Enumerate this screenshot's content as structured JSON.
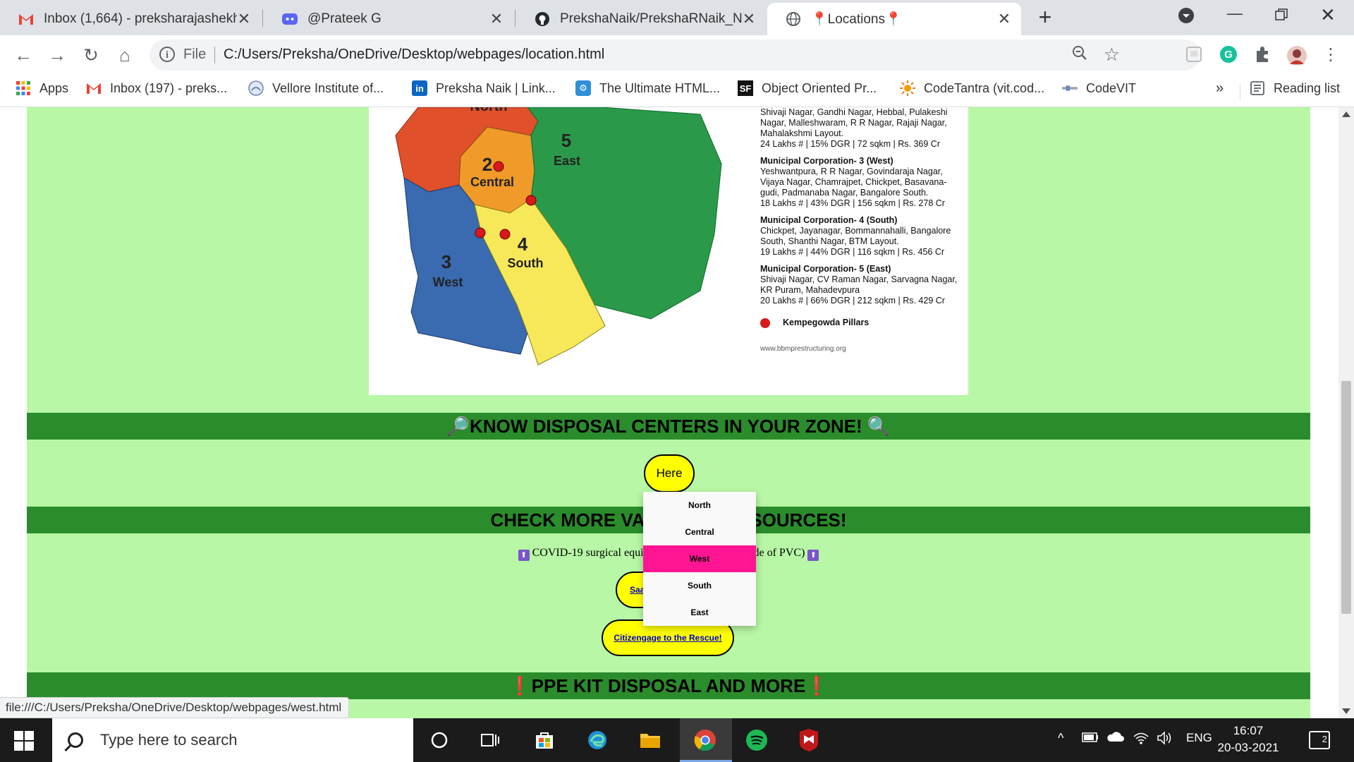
{
  "tabs": [
    {
      "title": "Inbox (1,664) - preksharajashekh...",
      "favicon": "gmail-icon"
    },
    {
      "title": "@Prateek G",
      "favicon": "discord-icon"
    },
    {
      "title": "PrekshaNaik/PrekshaRNaik_NMIT",
      "favicon": "github-icon"
    },
    {
      "title": "📍Locations📍",
      "favicon": "globe-icon"
    }
  ],
  "address": {
    "scheme_label": "File",
    "url": "C:/Users/Preksha/OneDrive/Desktop/webpages/location.html"
  },
  "bookmarks": {
    "apps": "Apps",
    "items": [
      "Inbox (197) - preks...",
      "Vellore Institute of...",
      "Preksha Naik | Link...",
      "The Ultimate HTML...",
      "Object Oriented Pr...",
      "CodeTantra (vit.cod...",
      "CodeVIT"
    ],
    "more": "»",
    "reading_list": "Reading list"
  },
  "map": {
    "zones": [
      {
        "number": "",
        "name": "North"
      },
      {
        "number": "2",
        "name": "Central"
      },
      {
        "number": "3",
        "name": "West"
      },
      {
        "number": "4",
        "name": "South"
      },
      {
        "number": "5",
        "name": "East"
      }
    ],
    "legend": [
      {
        "title": "",
        "body": "Shivaji Nagar, Gandhi Nagar, Hebbal, Pulakeshi Nagar, Malleshwaram, R R Nagar, Rajaji Nagar, Mahalakshmi Layout.",
        "stats": "24 Lakhs # | 15% DGR | 72 sqkm | Rs. 369 Cr"
      },
      {
        "title": "Municipal Corporation- 3 (West)",
        "body": "Yeshwantpura, R R Nagar, Govindaraja Nagar, Vijaya Nagar, Chamrajpet, Chickpet, Basavana-gudi, Padmanaba Nagar, Bangalore South.",
        "stats": "18 Lakhs # | 43% DGR | 156 sqkm | Rs. 278 Cr"
      },
      {
        "title": "Municipal Corporation- 4 (South)",
        "body": "Chickpet, Jayanagar, Bommannahalli, Bangalore South, Shanthi Nagar, BTM Layout.",
        "stats": "19 Lakhs # | 44% DGR | 116 sqkm | Rs. 456 Cr"
      },
      {
        "title": "Municipal Corporation- 5 (East)",
        "body": "Shivaji Nagar, CV Raman Nagar, Sarvagna Nagar, KR Puram, Mahadevpura",
        "stats": "20 Lakhs # | 66% DGR | 212 sqkm | Rs. 429 Cr"
      }
    ],
    "pillars_label": "Kempegowda Pillars",
    "website": "www.bbmprestructuring.org"
  },
  "sections": {
    "know_zone": "🔎KNOW DISPOSAL CENTERS IN YOUR ZONE! 🔍",
    "here_button": "Here",
    "check_more": "CHECK MORE VALUABLE RESOURCES!",
    "resource_text": "COVID-19 surgical equipment disposal bins (made of PVC)",
    "saahas_button": "Saahas",
    "citizengage_button": "Citizengage to the Rescue!",
    "ppe_banner": "❗PPE KIT DISPOSAL AND MORE❗"
  },
  "dropdown": {
    "items": [
      "North",
      "Central",
      "West",
      "South",
      "East"
    ],
    "highlighted": "West"
  },
  "status_url": "file:///C:/Users/Preksha/OneDrive/Desktop/webpages/west.html",
  "taskbar": {
    "search_placeholder": "Type here to search",
    "language": "ENG",
    "time": "16:07",
    "date": "20-03-2021",
    "notifications": "2"
  }
}
